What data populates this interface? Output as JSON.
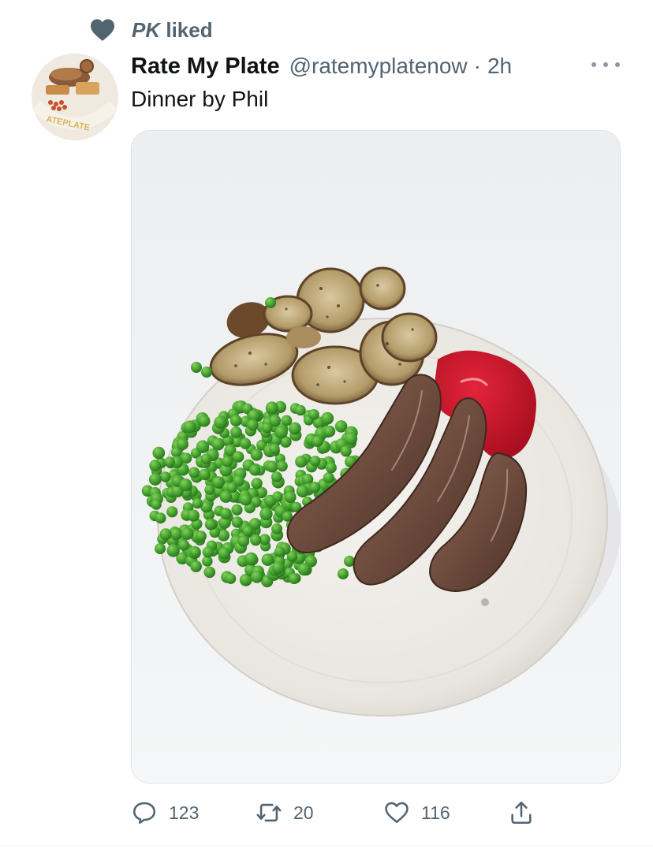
{
  "social_context": {
    "icon": "heart-icon",
    "name": "PK",
    "action": "liked"
  },
  "tweet": {
    "display_name": "Rate My Plate",
    "handle": "@ratemyplatenow",
    "separator": "·",
    "time": "2h",
    "text": "Dinner by Phil",
    "avatar_text": "RATE PLATE",
    "media": {
      "image": "photo of a white plate with sausages, peas, roast potatoes and ketchup"
    }
  },
  "actions": {
    "reply": {
      "icon": "reply-icon",
      "count": "123"
    },
    "retweet": {
      "icon": "retweet-icon",
      "count": "20"
    },
    "like": {
      "icon": "like-icon",
      "count": "116"
    },
    "share": {
      "icon": "share-icon"
    }
  },
  "colors": {
    "text_primary": "#0f1419",
    "text_secondary": "#536471",
    "heart_context": "#536471"
  }
}
